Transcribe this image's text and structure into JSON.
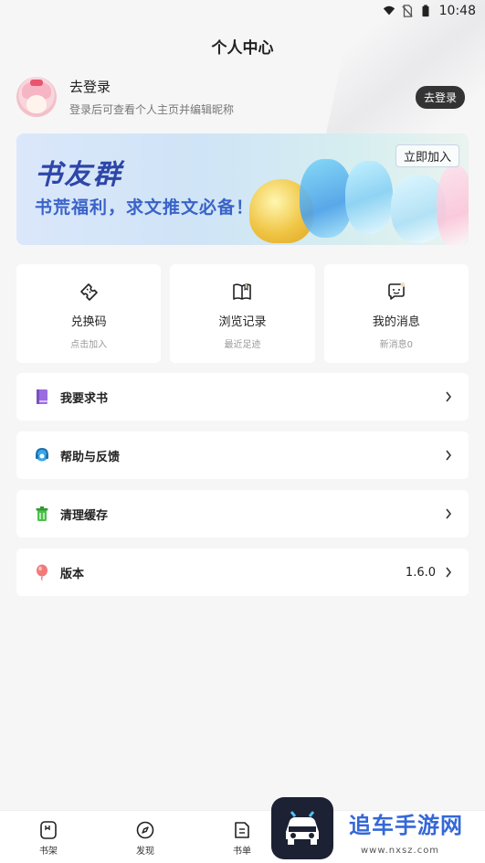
{
  "status_bar": {
    "time": "10:48"
  },
  "page": {
    "title": "个人中心"
  },
  "profile": {
    "name": "去登录",
    "subtitle": "登录后可查看个人主页并编辑昵称",
    "login_button": "去登录"
  },
  "banner": {
    "title": "书友群",
    "subtitle": "书荒福利，求文推文必备！",
    "join_button": "立即加入"
  },
  "shortcuts": [
    {
      "label": "兑换码",
      "sub": "点击加入",
      "icon": "ticket-icon"
    },
    {
      "label": "浏览记录",
      "sub": "最近足迹",
      "icon": "book-open-icon"
    },
    {
      "label": "我的消息",
      "sub": "新消息0",
      "icon": "message-icon"
    }
  ],
  "menu": [
    {
      "label": "我要求书",
      "icon": "book-request-icon",
      "value": ""
    },
    {
      "label": "帮助与反馈",
      "icon": "help-feedback-icon",
      "value": ""
    },
    {
      "label": "清理缓存",
      "icon": "trash-icon",
      "value": ""
    },
    {
      "label": "版本",
      "icon": "balloon-icon",
      "value": "1.6.0"
    }
  ],
  "bottom_nav": [
    {
      "label": "书架",
      "icon": "bookshelf-icon"
    },
    {
      "label": "发现",
      "icon": "compass-icon"
    },
    {
      "label": "书单",
      "icon": "booklist-icon"
    }
  ],
  "watermark": {
    "text": "追车手游网",
    "url": "www.nxsz.com"
  },
  "colors": {
    "accent": "#333333",
    "banner_text": "#2d46a8",
    "page_bg": "#f6f6f7"
  }
}
